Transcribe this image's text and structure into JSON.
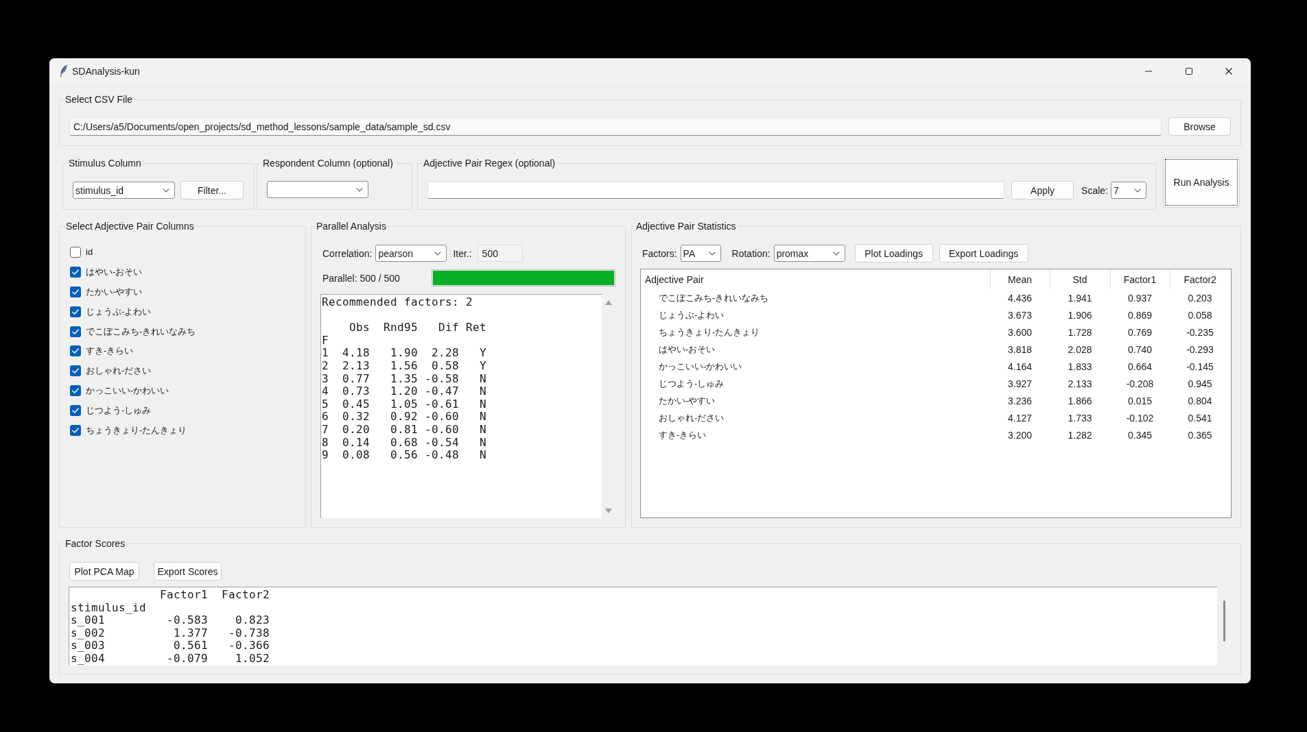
{
  "window": {
    "title": "SDAnalysis-kun"
  },
  "csv_file": {
    "label": "Select CSV File",
    "path": "C:/Users/a5/Documents/open_projects/sd_method_lessons/sample_data/sample_sd.csv",
    "browse_button": "Browse"
  },
  "stimulus_column": {
    "label": "Stimulus Column",
    "value": "stimulus_id",
    "filter_button": "Filter..."
  },
  "respondent_column": {
    "label": "Respondent Column (optional)"
  },
  "adjective_pair_regex": {
    "label": "Adjective Pair Regex (optional)",
    "apply_button": "Apply",
    "scale_label": "Scale:",
    "scale": "7"
  },
  "run_button": {
    "label": "Run Analysis",
    "focused": true
  },
  "adjective_pair_columns": {
    "label": "Select Adjective Pair Columns",
    "items": [
      {
        "label": "id",
        "checked": false
      },
      {
        "label": "はやい-おそい",
        "checked": true
      },
      {
        "label": "たかい-やすい",
        "checked": true
      },
      {
        "label": "じょうぶ-よわい",
        "checked": true
      },
      {
        "label": "でこぼこみち-きれいなみち",
        "checked": true
      },
      {
        "label": "すき-きらい",
        "checked": true
      },
      {
        "label": "おしゃれ-ださい",
        "checked": true
      },
      {
        "label": "かっこいい-かわいい",
        "checked": true
      },
      {
        "label": "じつよう-しゅみ",
        "checked": true
      },
      {
        "label": "ちょうきょり-たんきょり",
        "checked": true
      }
    ]
  },
  "parallel_analysis": {
    "label": "Parallel Analysis",
    "correlation_label": "Correlation:",
    "correlation": "pearson",
    "iterations_label": "Iter.:",
    "iterations": "500",
    "progress_text": "Parallel: 500 / 500",
    "progress": {
      "level": 1.0
    },
    "output": {
      "summary": "Recommended factors: 2",
      "columns": [
        "",
        "Obs",
        "Rnd95",
        "Dif",
        "Ret"
      ],
      "index_name": "F",
      "rows": [
        [
          "1",
          "4.18",
          "1.90",
          "2.28",
          "Y"
        ],
        [
          "2",
          "2.13",
          "1.56",
          "0.58",
          "Y"
        ],
        [
          "3",
          "0.77",
          "1.35",
          "-0.58",
          "N"
        ],
        [
          "4",
          "0.73",
          "1.20",
          "-0.47",
          "N"
        ],
        [
          "5",
          "0.45",
          "1.05",
          "-0.61",
          "N"
        ],
        [
          "6",
          "0.32",
          "0.92",
          "-0.60",
          "N"
        ],
        [
          "7",
          "0.20",
          "0.81",
          "-0.60",
          "N"
        ],
        [
          "8",
          "0.14",
          "0.68",
          "-0.54",
          "N"
        ],
        [
          "9",
          "0.08",
          "0.56",
          "-0.48",
          "N"
        ]
      ]
    }
  },
  "adjective_pair_statistics": {
    "label": "Adjective Pair Statistics",
    "factors_label": "Factors:",
    "factors": "PA",
    "rotation_label": "Rotation:",
    "rotation": "promax",
    "plot_button": "Plot Loadings",
    "export_button": "Export Loadings",
    "table": {
      "columns": [
        "Adjective Pair",
        "Mean",
        "Std",
        "Factor1",
        "Factor2"
      ],
      "rows": [
        [
          "でこぼこみち-きれいなみち",
          "4.436",
          "1.941",
          "0.937",
          "0.203"
        ],
        [
          "じょうぶ-よわい",
          "3.673",
          "1.906",
          "0.869",
          "0.058"
        ],
        [
          "ちょうきょり-たんきょり",
          "3.600",
          "1.728",
          "0.769",
          "-0.235"
        ],
        [
          "はやい-おそい",
          "3.818",
          "2.028",
          "0.740",
          "-0.293"
        ],
        [
          "かっこいい-かわいい",
          "4.164",
          "1.833",
          "0.664",
          "-0.145"
        ],
        [
          "じつよう-しゅみ",
          "3.927",
          "2.133",
          "-0.208",
          "0.945"
        ],
        [
          "たかい-やすい",
          "3.236",
          "1.866",
          "0.015",
          "0.804"
        ],
        [
          "おしゃれ-ださい",
          "4.127",
          "1.733",
          "-0.102",
          "0.541"
        ],
        [
          "すき-きらい",
          "3.200",
          "1.282",
          "0.345",
          "0.365"
        ]
      ]
    }
  },
  "factor_scores": {
    "label": "Factor Scores",
    "plot_button": "Plot PCA Map",
    "export_button": "Export Scores",
    "output": {
      "columns": [
        "",
        "Factor1",
        "Factor2"
      ],
      "index_name": "stimulus_id",
      "rows": [
        [
          "s_001",
          "-0.583",
          "0.823"
        ],
        [
          "s_002",
          "1.377",
          "-0.738"
        ],
        [
          "s_003",
          "0.561",
          "-0.366"
        ],
        [
          "s_004",
          "-0.079",
          "1.052"
        ]
      ]
    }
  }
}
